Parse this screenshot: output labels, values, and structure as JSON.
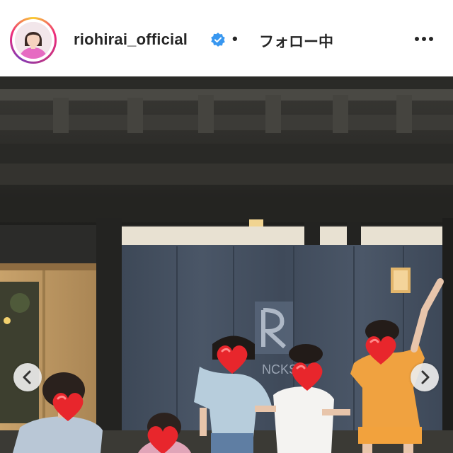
{
  "post_header": {
    "username": "riohirai_official",
    "verified": true,
    "separator": "•",
    "follow_status": "フォロー中",
    "more_icon": "more-options-icon",
    "avatar_ring_colors": [
      "#f9ce34",
      "#ee2a7b",
      "#833ab4"
    ]
  },
  "photo": {
    "sign_text": "NCKS",
    "nav": {
      "prev_icon": "chevron-left-icon",
      "next_icon": "chevron-right-icon"
    }
  },
  "colors": {
    "verified_badge": "#3897f0",
    "text": "#262626",
    "heart": "#e8262c"
  }
}
